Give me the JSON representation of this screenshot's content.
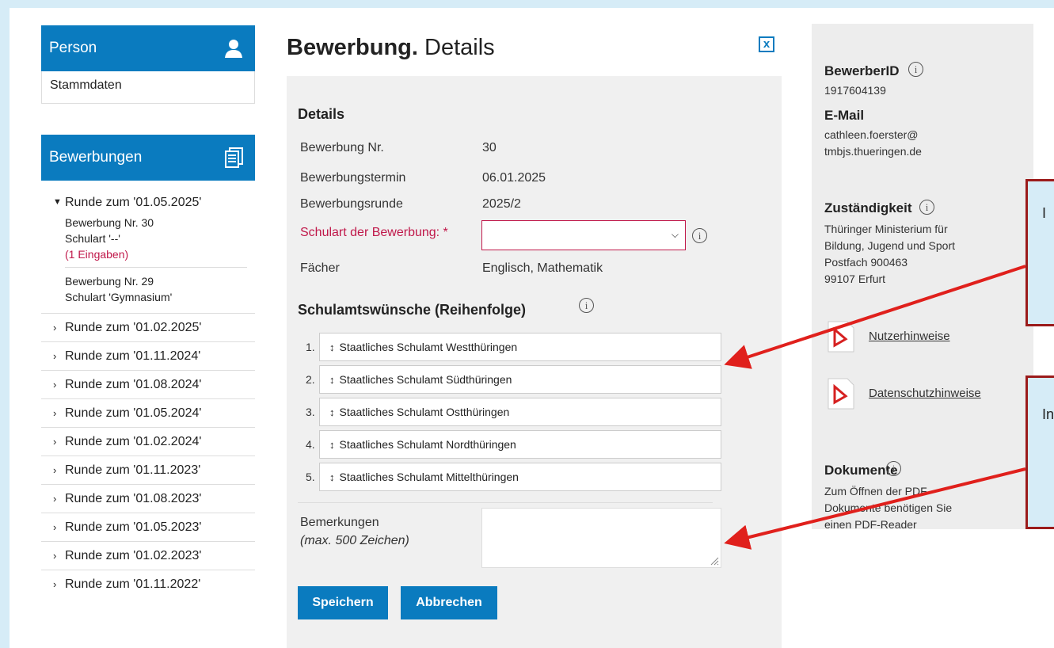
{
  "sidebar": {
    "person_header": "Person",
    "stammdaten": "Stammdaten",
    "bewerbungen_header": "Bewerbungen",
    "open_round": {
      "title": "Runde zum '01.05.2025'",
      "entries": [
        {
          "line1": "Bewerbung Nr. 30",
          "line2": "Schulart '--'",
          "line3": "(1 Eingaben)"
        },
        {
          "line1": "Bewerbung Nr. 29",
          "line2": "Schulart 'Gymnasium'"
        }
      ]
    },
    "rounds": [
      "Runde zum '01.02.2025'",
      "Runde zum '01.11.2024'",
      "Runde zum '01.08.2024'",
      "Runde zum '01.05.2024'",
      "Runde zum '01.02.2024'",
      "Runde zum '01.11.2023'",
      "Runde zum '01.08.2023'",
      "Runde zum '01.05.2023'",
      "Runde zum '01.02.2023'",
      "Runde zum '01.11.2022'"
    ]
  },
  "main": {
    "title_bold": "Bewerbung.",
    "title_rest": " Details",
    "close_label": "x",
    "details_title": "Details",
    "rows": [
      {
        "label": "Bewerbung Nr.",
        "value": "30"
      },
      {
        "label": "Bewerbungstermin",
        "value": "06.01.2025"
      },
      {
        "label": "Bewerbungsrunde",
        "value": "2025/2"
      }
    ],
    "schulart_label": "Schulart der Bewerbung:",
    "schulart_req": " *",
    "schulart_value": "",
    "faecher_label": "Fächer",
    "faecher_value": "Englisch, Mathematik",
    "wishes_title": "Schulamtswünsche (Reihenfolge)",
    "wishes": [
      {
        "num": "1.",
        "label": "Staatliches Schulamt Westthüringen"
      },
      {
        "num": "2.",
        "label": "Staatliches Schulamt Südthüringen"
      },
      {
        "num": "3.",
        "label": "Staatliches Schulamt Ostthüringen"
      },
      {
        "num": "4.",
        "label": "Staatliches Schulamt Nordthüringen"
      },
      {
        "num": "5.",
        "label": "Staatliches Schulamt Mittelthüringen"
      }
    ],
    "bemerkungen_label": "Bemerkungen",
    "bemerkungen_hint": "(max. 500 Zeichen)",
    "save_label": "Speichern",
    "cancel_label": "Abbrechen"
  },
  "info": {
    "bewerber_id_label": "BewerberID",
    "bewerber_id": "1917604139",
    "email_label": "E-Mail",
    "email_line1": "cathleen.foerster@",
    "email_line2": "tmbjs.thueringen.de",
    "zust_label": "Zuständigkeit",
    "zust_lines": [
      "Thüringer Ministerium für",
      "Bildung, Jugend und Sport",
      "Postfach 900463",
      "99107 Erfurt"
    ],
    "link1": "Nutzerhinweise",
    "link2": "Datenschutzhinweise",
    "doc_label": "Dokumente",
    "doc_lines": [
      "Zum Öffnen der PDF-",
      "Dokumente benötigen Sie",
      "einen PDF-Reader"
    ]
  },
  "callouts": [
    "I",
    "In"
  ],
  "colors": {
    "accent": "#0a7bbf",
    "required": "#c0184a",
    "callout_border": "#9b1b1b",
    "arrow": "#e0201c"
  }
}
